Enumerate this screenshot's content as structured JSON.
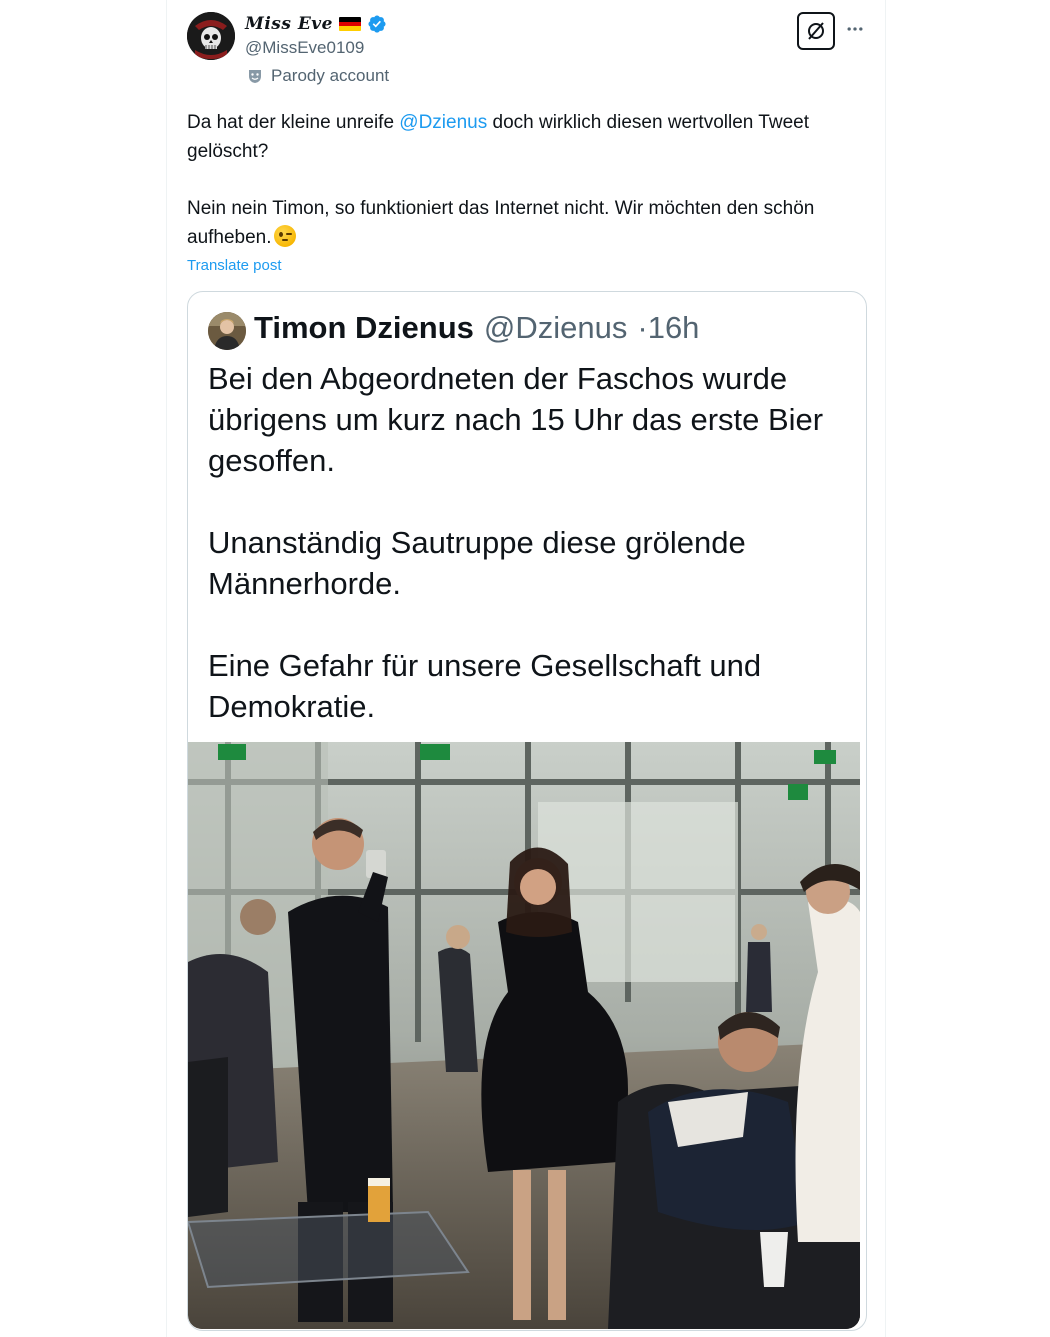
{
  "post": {
    "author": {
      "display_name": "Miss Eve",
      "handle": "@MissEve0109",
      "verified": true,
      "label": "Parody account",
      "avatar_icon": "skull-avatar-icon"
    },
    "text": {
      "line1_before": "Da hat der kleine unreife ",
      "line1_mention": "@Dzienus",
      "line1_after": " doch wirklich diesen wertvollen Tweet gelöscht?",
      "paragraph2": "Nein nein Timon, so funktioniert das Internet nicht. Wir möchten den schön aufheben."
    },
    "translate_label": "Translate post",
    "actions": {
      "grok_icon": "grok-icon",
      "more_icon": "more-dots-icon"
    }
  },
  "quoted": {
    "display_name": "Timon Dzienus",
    "handle": "@Dzienus",
    "separator": "·",
    "time": "16h",
    "paragraph1": "Bei den Abgeordneten der Faschos wurde übrigens um kurz nach 15 Uhr das erste Bier gesoffen.",
    "paragraph2": "Unanständig Sautruppe diese grölende Männerhorde.",
    "paragraph3": "Eine Gefahr für unsere Gesellschaft und Demokratie."
  },
  "colors": {
    "accent": "#1d9bf0",
    "text_primary": "#0f1419",
    "text_secondary": "#536471",
    "border": "#cfd9de"
  }
}
